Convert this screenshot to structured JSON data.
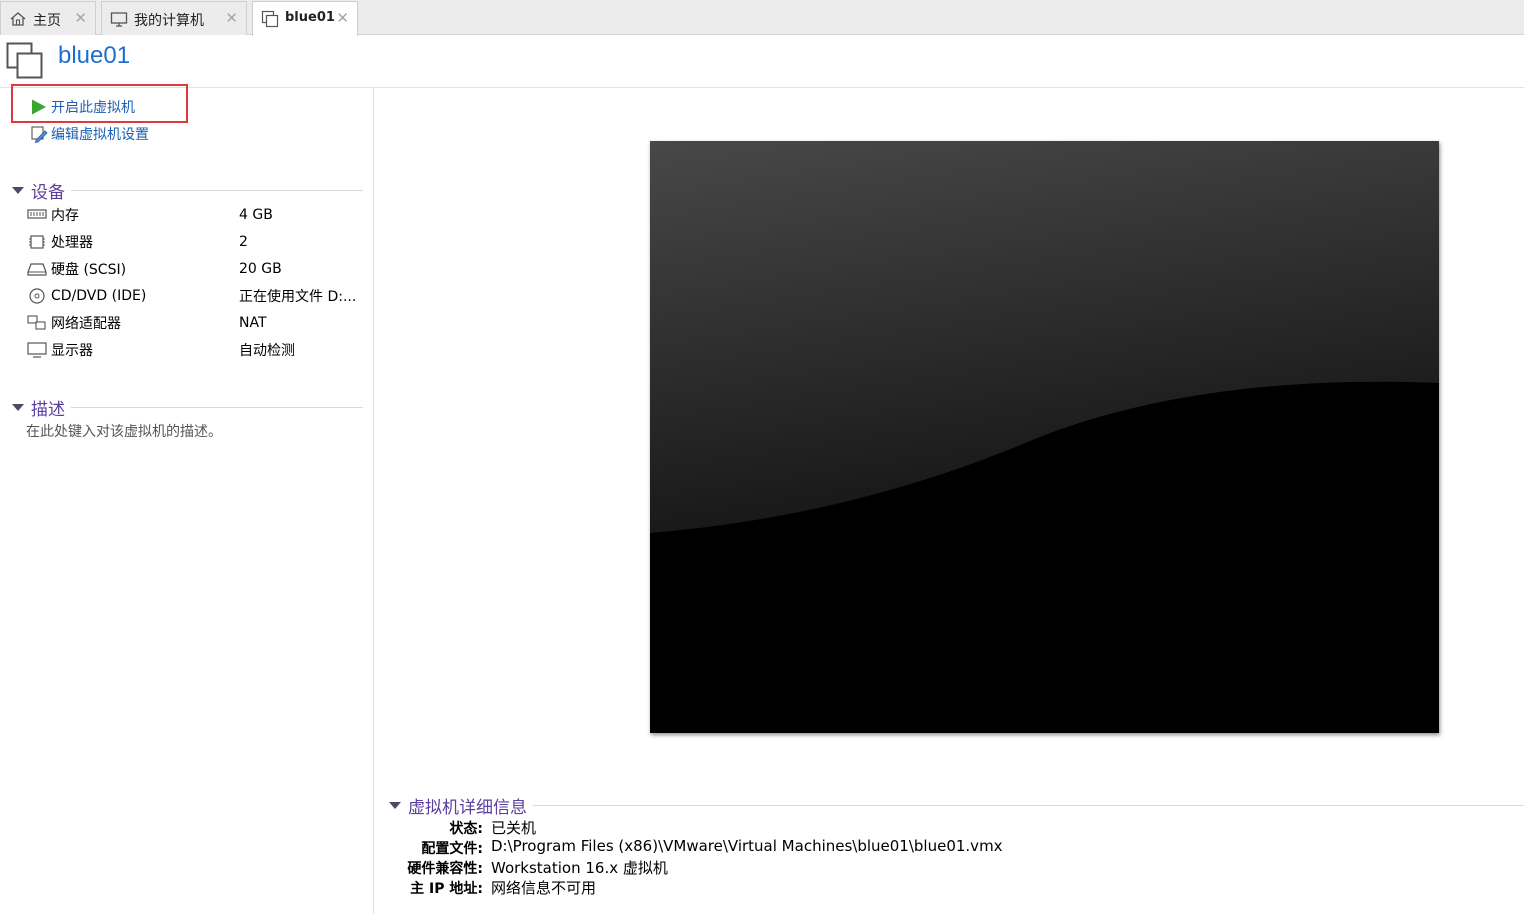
{
  "tabs": [
    {
      "label": "主页",
      "icon": "home-icon",
      "close": "✕"
    },
    {
      "label": "我的计算机",
      "icon": "computer-icon",
      "close": "✕"
    },
    {
      "label": "blue01",
      "icon": "vm-icon",
      "close": "✕"
    }
  ],
  "vm": {
    "title": "blue01"
  },
  "actions": {
    "start": "开启此虚拟机",
    "edit": "编辑虚拟机设置"
  },
  "devices": {
    "title": "设备",
    "items": [
      {
        "name": "内存",
        "value": "4 GB",
        "icon": "memory-icon"
      },
      {
        "name": "处理器",
        "value": "2",
        "icon": "processor-icon"
      },
      {
        "name": "硬盘 (SCSI)",
        "value": "20 GB",
        "icon": "hard-disk-icon"
      },
      {
        "name": "CD/DVD (IDE)",
        "value": "正在使用文件 D:...",
        "icon": "cd-dvd-icon"
      },
      {
        "name": "网络适配器",
        "value": "NAT",
        "icon": "network-adapter-icon"
      },
      {
        "name": "显示器",
        "value": "自动检测",
        "icon": "display-icon"
      }
    ]
  },
  "description": {
    "title": "描述",
    "placeholder": "在此处键入对该虚拟机的描述。"
  },
  "details": {
    "title": "虚拟机详细信息",
    "rows": [
      {
        "key": "状态:",
        "value": "已关机"
      },
      {
        "key": "配置文件:",
        "value": "D:\\Program Files (x86)\\VMware\\Virtual Machines\\blue01\\blue01.vmx"
      },
      {
        "key": "硬件兼容性:",
        "value": "Workstation 16.x 虚拟机"
      },
      {
        "key": "主 IP 地址:",
        "value": "网络信息不可用"
      }
    ]
  },
  "colors": {
    "accent": "#1f6fcf",
    "section_title": "#5b3fa0",
    "highlight_box": "#e0393d",
    "play_green": "#3aa62f"
  }
}
